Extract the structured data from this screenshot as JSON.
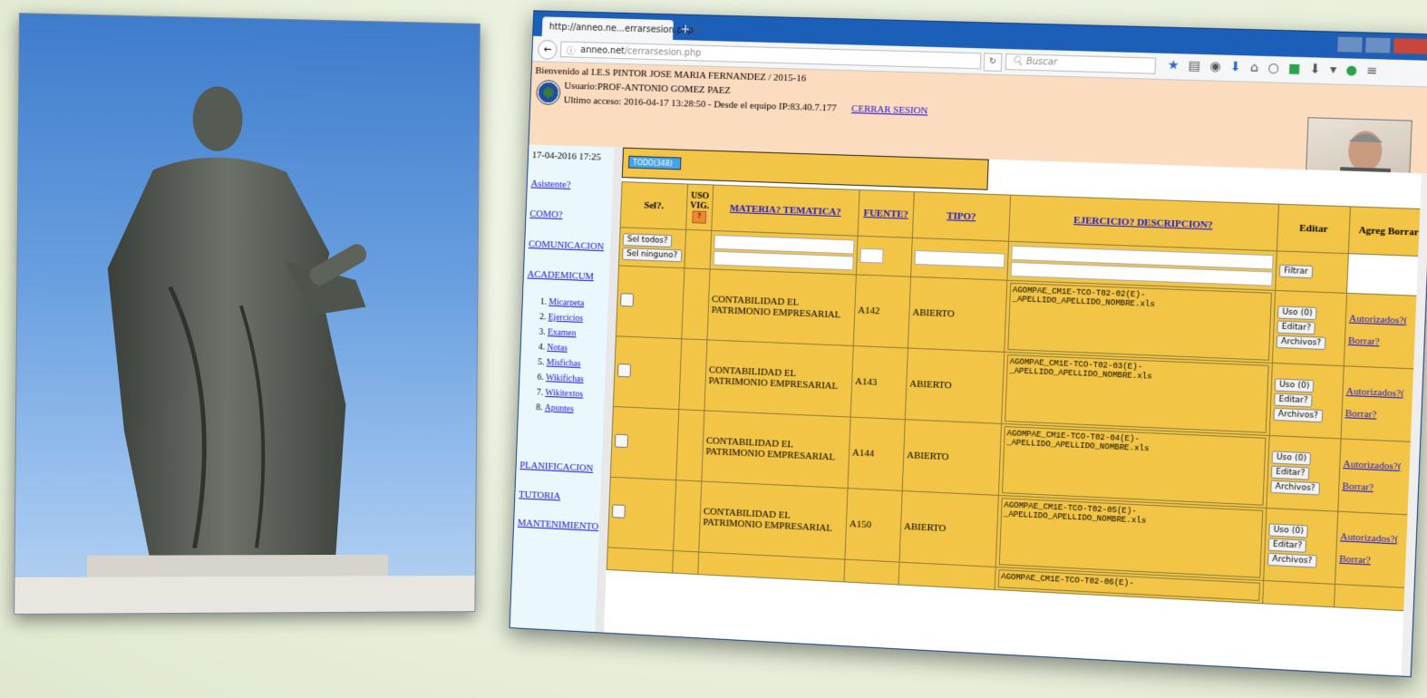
{
  "browser": {
    "tab_title": "http://anneo.ne...errarsesion.php",
    "tab_close": "×",
    "new_tab": "+",
    "url_host": "anneo.net",
    "url_path": "/cerrarsesion.php",
    "search_placeholder": "Buscar"
  },
  "header": {
    "welcome": "Bienvenido al I.E.S PINTOR JOSE MARIA FERNANDEZ / 2015-16",
    "user": "Usuario:PROF-ANTONIO GOMEZ PAEZ",
    "access": "Ultimo acceso: 2016-04-17 13:28:50 - Desde el equipo IP:83.40.7.177",
    "logout": "CERRAR SESION"
  },
  "sidebar": {
    "date": "17-04-2016 17:25",
    "links": [
      "Asistente?",
      "COMO?",
      "COMUNICACION",
      "ACADEMICUM"
    ],
    "submenu": [
      "Micarpeta",
      "Ejercicios",
      "Examen",
      "Notas",
      "Misfichas",
      "Wikifichas",
      "Wikitextos",
      "Apuntes"
    ],
    "bottom_links": [
      "PLANIFICACION",
      "TUTORIA",
      "MANTENIMIENTO"
    ]
  },
  "filter": {
    "todo_label": "TODO(348)"
  },
  "table": {
    "headers": {
      "sel": "Sel?.",
      "uso": "USO VIG.",
      "uso_q": "?",
      "materia": "MATERIA? TEMATICA?",
      "fuente": "FUENTE?",
      "tipo": "TIPO?",
      "ejercicio": "EJERCICIO? DESCRIPCION?",
      "editar": "Editar",
      "agreg": "Agreg Borrar"
    },
    "sel_all": "Sel todos?",
    "sel_none": "Sel ninguno?",
    "filter_button": "Filtrar",
    "rows": [
      {
        "materia": "CONTABILIDAD EL PATRIMONIO EMPRESARIAL",
        "fuente": "A142",
        "tipo": "ABIERTO",
        "desc": "AGOMPAE_CM1E-TCO-T02-02(E)-_APELLIDO_APELLIDO_NOMBRE.xls",
        "uso": "Uso (0)",
        "editar": "Editar?",
        "archivos": "Archivos?",
        "autorizados": "Autorizados?(",
        "borrar": "Borrar?"
      },
      {
        "materia": "CONTABILIDAD EL PATRIMONIO EMPRESARIAL",
        "fuente": "A143",
        "tipo": "ABIERTO",
        "desc": "AGOMPAE_CM1E-TCO-T02-03(E)-_APELLIDO_APELLIDO_NOMBRE.xls",
        "uso": "Uso (0)",
        "editar": "Editar?",
        "archivos": "Archivos?",
        "autorizados": "Autorizados?(",
        "borrar": "Borrar?"
      },
      {
        "materia": "CONTABILIDAD EL PATRIMONIO EMPRESARIAL",
        "fuente": "A144",
        "tipo": "ABIERTO",
        "desc": "AGOMPAE_CM1E-TCO-T02-04(E)-_APELLIDO_APELLIDO_NOMBRE.xls",
        "uso": "Uso (0)",
        "editar": "Editar?",
        "archivos": "Archivos?",
        "autorizados": "Autorizados?(",
        "borrar": "Borrar?"
      },
      {
        "materia": "CONTABILIDAD EL PATRIMONIO EMPRESARIAL",
        "fuente": "A150",
        "tipo": "ABIERTO",
        "desc": "AGOMPAE_CM1E-TCO-T02-05(E)-_APELLIDO_APELLIDO_NOMBRE.xls",
        "uso": "Uso (0)",
        "editar": "Editar?",
        "archivos": "Archivos?",
        "autorizados": "Autorizados?(",
        "borrar": "Borrar?"
      }
    ],
    "partial_row_desc": "AGOMPAE_CM1E-TCO-T02-06(E)-"
  },
  "colors": {
    "table_bg": "#f3c546",
    "header_bg": "#fcdcbf",
    "sidebar_bg": "#eaf7fc",
    "link": "#1a0fd6",
    "window_frame": "#1c5fb8"
  }
}
